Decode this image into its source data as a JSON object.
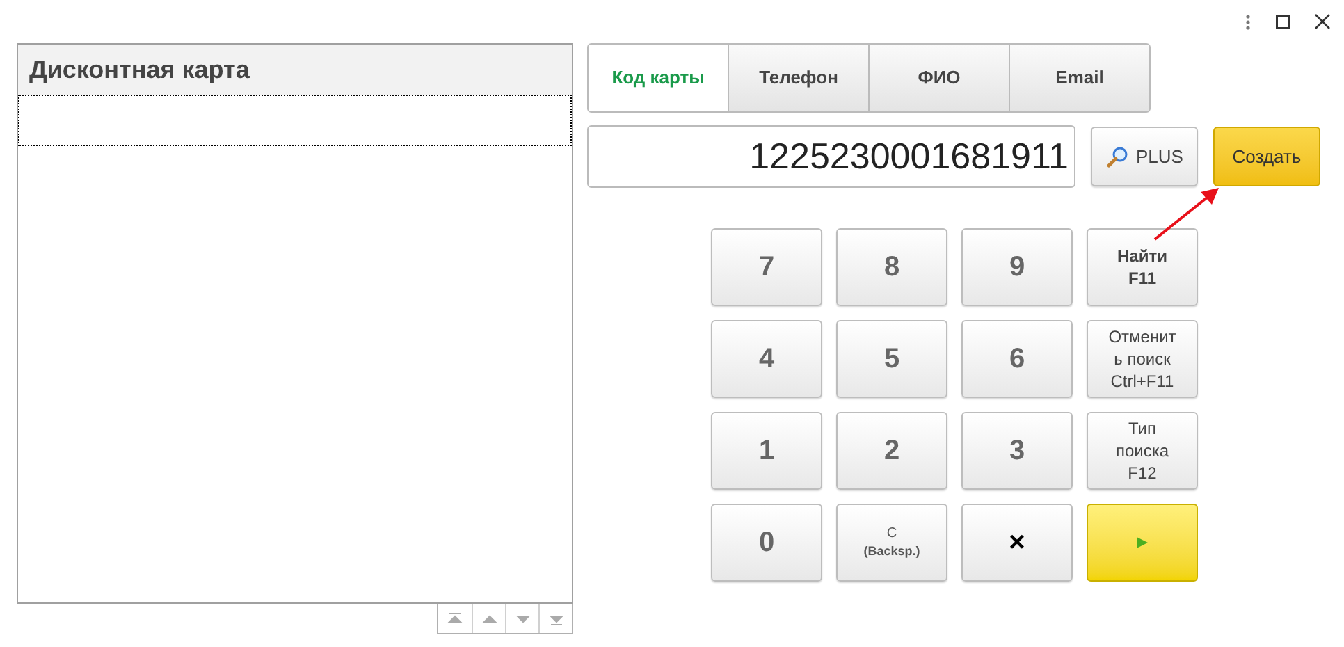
{
  "table": {
    "column_1": "Дисконтная карта",
    "rows": [
      {
        "selected": true
      }
    ]
  },
  "tabs": [
    {
      "label": "Код карты",
      "selected": true
    },
    {
      "label": "Телефон",
      "selected": false
    },
    {
      "label": "ФИО",
      "selected": false
    },
    {
      "label": "Email",
      "selected": false
    }
  ],
  "search": {
    "value": "1225230001681911"
  },
  "plus_button": "PLUS",
  "create_button": "Создать",
  "keys": [
    {
      "kind": "digit",
      "label": "7"
    },
    {
      "kind": "digit",
      "label": "8"
    },
    {
      "kind": "digit",
      "label": "9"
    },
    {
      "kind": "action",
      "label": "Найти F11"
    },
    {
      "kind": "digit",
      "label": "4"
    },
    {
      "kind": "digit",
      "label": "5"
    },
    {
      "kind": "digit",
      "label": "6"
    },
    {
      "kind": "text",
      "label": "Отменит ь поиск Ctrl+F11"
    },
    {
      "kind": "digit",
      "label": "1"
    },
    {
      "kind": "digit",
      "label": "2"
    },
    {
      "kind": "digit",
      "label": "3"
    },
    {
      "kind": "text",
      "label": "Тип поиска F12"
    },
    {
      "kind": "digit",
      "label": "0"
    },
    {
      "kind": "clear",
      "label": "C",
      "sub": "(Backsp.)"
    },
    {
      "kind": "delete",
      "label": "×"
    },
    {
      "kind": "enter"
    }
  ]
}
